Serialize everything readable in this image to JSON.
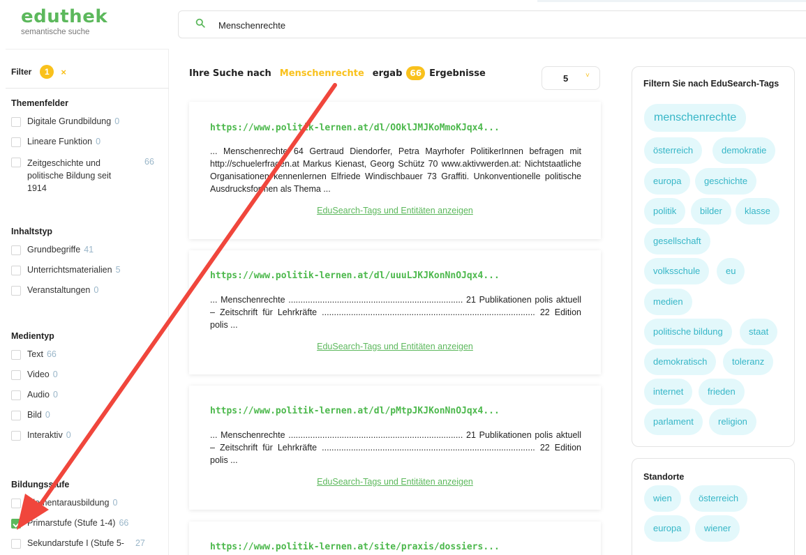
{
  "app": {
    "logo": "eduthek",
    "logo_sub": "semantische suche"
  },
  "search": {
    "value": "Menschenrechte"
  },
  "filter": {
    "label": "Filter",
    "active_count": "1",
    "clear": "×"
  },
  "groups": {
    "themenfelder": {
      "title": "Themenfelder",
      "options": [
        {
          "label": "Digitale Grundbildung",
          "count": "0"
        },
        {
          "label": "Lineare Funktion",
          "count": "0"
        },
        {
          "label": "Zeitgeschichte und politische Bildung seit 1914",
          "count": "66"
        }
      ]
    },
    "inhaltstyp": {
      "title": "Inhaltstyp",
      "options": [
        {
          "label": "Grundbegriffe",
          "count": "41"
        },
        {
          "label": "Unterrichtsmaterialien",
          "count": "5"
        },
        {
          "label": "Veranstaltungen",
          "count": "0"
        }
      ]
    },
    "medientyp": {
      "title": "Medientyp",
      "options": [
        {
          "label": "Text",
          "count": "66"
        },
        {
          "label": "Video",
          "count": "0"
        },
        {
          "label": "Audio",
          "count": "0"
        },
        {
          "label": "Bild",
          "count": "0"
        },
        {
          "label": "Interaktiv",
          "count": "0"
        }
      ]
    },
    "bildungsstufe": {
      "title": "Bildungsstufe",
      "options": [
        {
          "label": "Elementarausbildung",
          "count": "0"
        },
        {
          "label": "Primarstufe (Stufe 1-4)",
          "count": "66"
        },
        {
          "label": "Sekundarstufe I (Stufe 5-",
          "count": "27"
        }
      ]
    }
  },
  "results": {
    "prefix": "Ihre Suche nach",
    "term": "Menschenrechte",
    "middle": "ergab",
    "count": "66",
    "suffix": "Ergebnisse",
    "page_size": "5",
    "page_size_chevron": "˅",
    "tags_link": "EduSearch-Tags und Entitäten anzeigen",
    "items": [
      {
        "url": "https://www.politik-lernen.at/dl/OOklJMJKoMmoKJqx4...",
        "snippet": "... Menschenrechte 64 Gertraud Diendorfer, Petra Mayrhofer PolitikerInnen befragen mit http://schuelerfragen.at Markus Kienast, Georg Schütz 70 www.aktivwerden.at: Nichtstaatliche Organisationen kennenlernen Elfriede Windischbauer 73 Graffiti. Unkonventionelle politische Ausdrucksformen als Thema ..."
      },
      {
        "url": "https://www.politik-lernen.at/dl/uuuLJKJKonNnOJqx4...",
        "snippet": "... Menschenrechte ........................................................................ 21 Publikationen polis aktuell – Zeitschrift für Lehrkräfte ........................................................................................ 22 Edition polis ..."
      },
      {
        "url": "https://www.politik-lernen.at/dl/pMtpJKJKonNnOJqx4...",
        "snippet": "... Menschenrechte ........................................................................ 21 Publikationen polis aktuell – Zeitschrift für Lehrkräfte ........................................................................................ 22 Edition polis ..."
      },
      {
        "url": "https://www.politik-lernen.at/site/praxis/dossiers..."
      }
    ]
  },
  "tag_panel": {
    "title": "Filtern Sie nach EduSearch-Tags",
    "tags": [
      "menschenrechte",
      "österreich",
      "demokratie",
      "europa",
      "geschichte",
      "politik",
      "bilder",
      "klasse",
      "gesellschaft",
      "volksschule",
      "eu",
      "medien",
      "politische bildung",
      "staat",
      "demokratisch",
      "toleranz",
      "internet",
      "frieden",
      "parlament",
      "religion"
    ]
  },
  "standorte_panel": {
    "title": "Standorte",
    "tags": [
      "wien",
      "österreich",
      "europa",
      "wiener"
    ]
  },
  "colors": {
    "brand_green": "#5cb85c",
    "accent_yellow": "#f9c11c",
    "chip_bg": "#e3f8fb",
    "chip_text": "#36b6c7",
    "arrow_red": "#f0463c"
  }
}
